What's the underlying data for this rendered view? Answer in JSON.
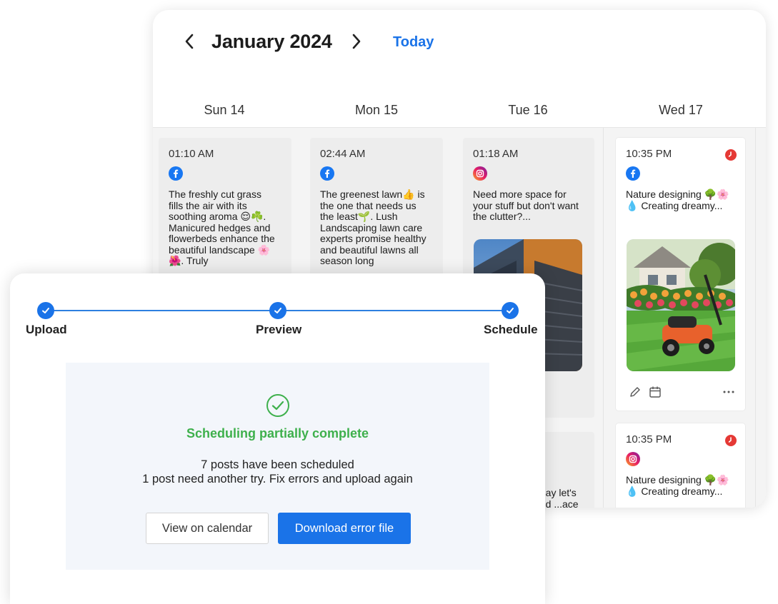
{
  "calendar": {
    "month": "January 2024",
    "today_label": "Today",
    "days": [
      "Sun 14",
      "Mon 15",
      "Tue 16",
      "Wed 17"
    ],
    "posts": [
      {
        "time": "01:10 AM",
        "network": "facebook",
        "text": "The freshly cut grass fills the air with its soothing aroma 😌☘️. Manicured hedges and flowerbeds enhance the beautiful landscape 🌸🌺. Truly"
      },
      {
        "time": "02:44 AM",
        "network": "facebook",
        "text": "The greenest lawn👍 is the one that needs us the least🌱. Lush Landscaping lawn care experts promise healthy and beautiful lawns all season long"
      },
      {
        "time": "01:18 AM",
        "network": "instagram",
        "text": "Need more space for your stuff but don't want the clutter?..."
      },
      {
        "time": "10:35 PM",
        "network": "facebook",
        "text": "Nature designing 🌳🌸💧 Creating dreamy..."
      },
      {
        "time": "10:35 PM",
        "network": "instagram",
        "text": "Nature designing 🌳🌸💧 Creating dreamy..."
      },
      {
        "text": "...ay let's ...d ...ace"
      }
    ],
    "colors": {
      "accent": "#1a73e8",
      "error": "#e53935",
      "facebook": "#1877f2"
    }
  },
  "upload": {
    "steps": [
      "Upload",
      "Preview",
      "Schedule"
    ],
    "status_title": "Scheduling partially complete",
    "line1": "7 posts have been scheduled",
    "line2": "1 post need another try. Fix errors and upload again",
    "view_button": "View on calendar",
    "download_button": "Download error file",
    "colors": {
      "success": "#3eb04c"
    }
  }
}
